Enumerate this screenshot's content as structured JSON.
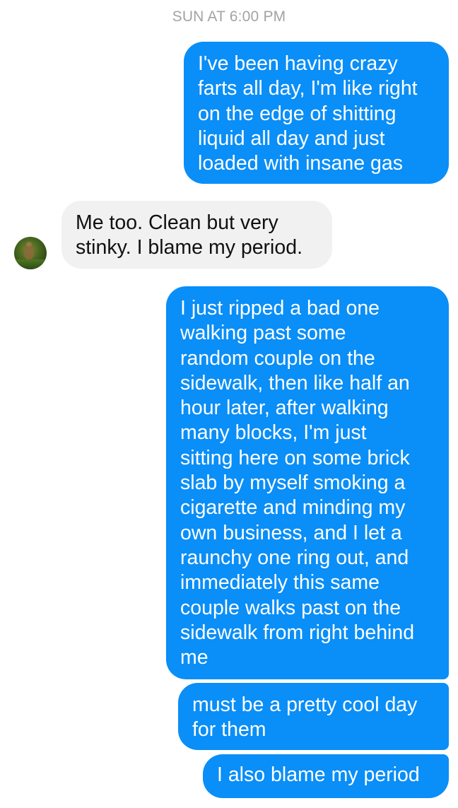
{
  "timestamp": "SUN AT 6:00 PM",
  "messages": [
    {
      "direction": "outgoing",
      "text": "I've been having crazy\nfarts all day, I'm like right\non the edge of shitting\nliquid all day and just\nloaded with insane gas"
    },
    {
      "direction": "incoming",
      "text": "Me too. Clean but very\nstinky. I blame my period."
    },
    {
      "direction": "outgoing",
      "text": "I just ripped a bad one\nwalking past some\nrandom couple on the\nsidewalk, then like half an\nhour later, after walking\nmany blocks, I'm just\nsitting here on some brick\nslab by myself smoking a\ncigarette and minding my\nown business, and I let a\nraunchy one ring out, and\nimmediately this same\ncouple walks past on the\nsidewalk from right behind\nme"
    },
    {
      "direction": "outgoing",
      "text": "must be a pretty cool day\nfor them"
    },
    {
      "direction": "outgoing",
      "text": "I also blame my period"
    }
  ],
  "colors": {
    "outgoing_bubble": "#0a8ef7",
    "incoming_bubble": "#f1f1f1",
    "timestamp_text": "#a3a3a3"
  }
}
